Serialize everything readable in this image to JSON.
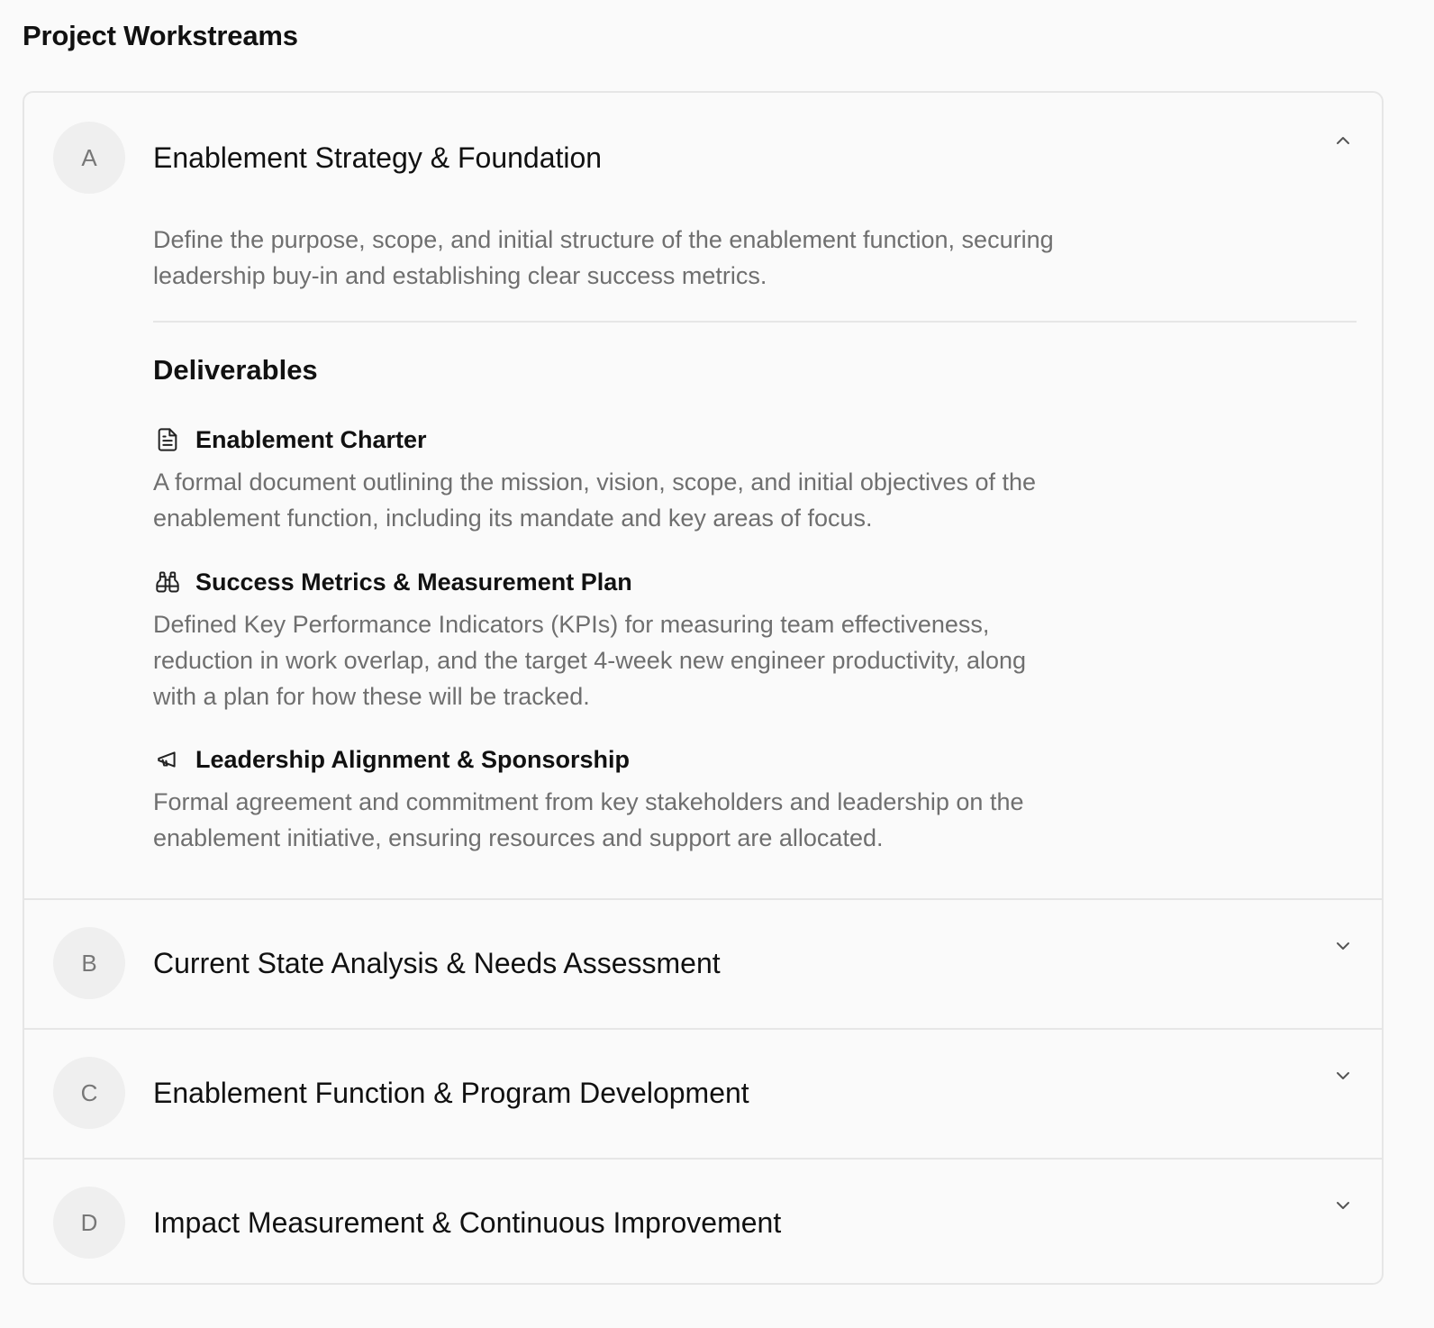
{
  "page": {
    "title": "Project Workstreams"
  },
  "workstreams": [
    {
      "letter": "A",
      "title": "Enablement Strategy & Foundation",
      "expanded": true,
      "chevron": "chevron-up-icon",
      "description": "Define the purpose, scope, and initial structure of the enablement function, securing leadership buy-in and establishing clear success metrics.",
      "deliverables_heading": "Deliverables",
      "deliverables": [
        {
          "icon": "document-icon",
          "title": "Enablement Charter",
          "description": "A formal document outlining the mission, vision, scope, and initial objectives of the enablement function, including its mandate and key areas of focus."
        },
        {
          "icon": "binoculars-icon",
          "title": "Success Metrics & Measurement Plan",
          "description": "Defined Key Performance Indicators (KPIs) for measuring team effectiveness, reduction in work overlap, and the target 4-week new engineer productivity, along with a plan for how these will be tracked."
        },
        {
          "icon": "megaphone-icon",
          "title": "Leadership Alignment & Sponsorship",
          "description": "Formal agreement and commitment from key stakeholders and leadership on the enablement initiative, ensuring resources and support are allocated."
        }
      ]
    },
    {
      "letter": "B",
      "title": "Current State Analysis & Needs Assessment",
      "expanded": false,
      "chevron": "chevron-down-icon"
    },
    {
      "letter": "C",
      "title": "Enablement Function & Program Development",
      "expanded": false,
      "chevron": "chevron-down-icon"
    },
    {
      "letter": "D",
      "title": "Impact Measurement & Continuous Improvement",
      "expanded": false,
      "chevron": "chevron-down-icon"
    }
  ],
  "colors": {
    "background": "#fafafa",
    "border": "#e6e6e6",
    "circle_bg": "#efefef",
    "muted_text": "#6f6f6f",
    "primary_text": "#111111"
  }
}
